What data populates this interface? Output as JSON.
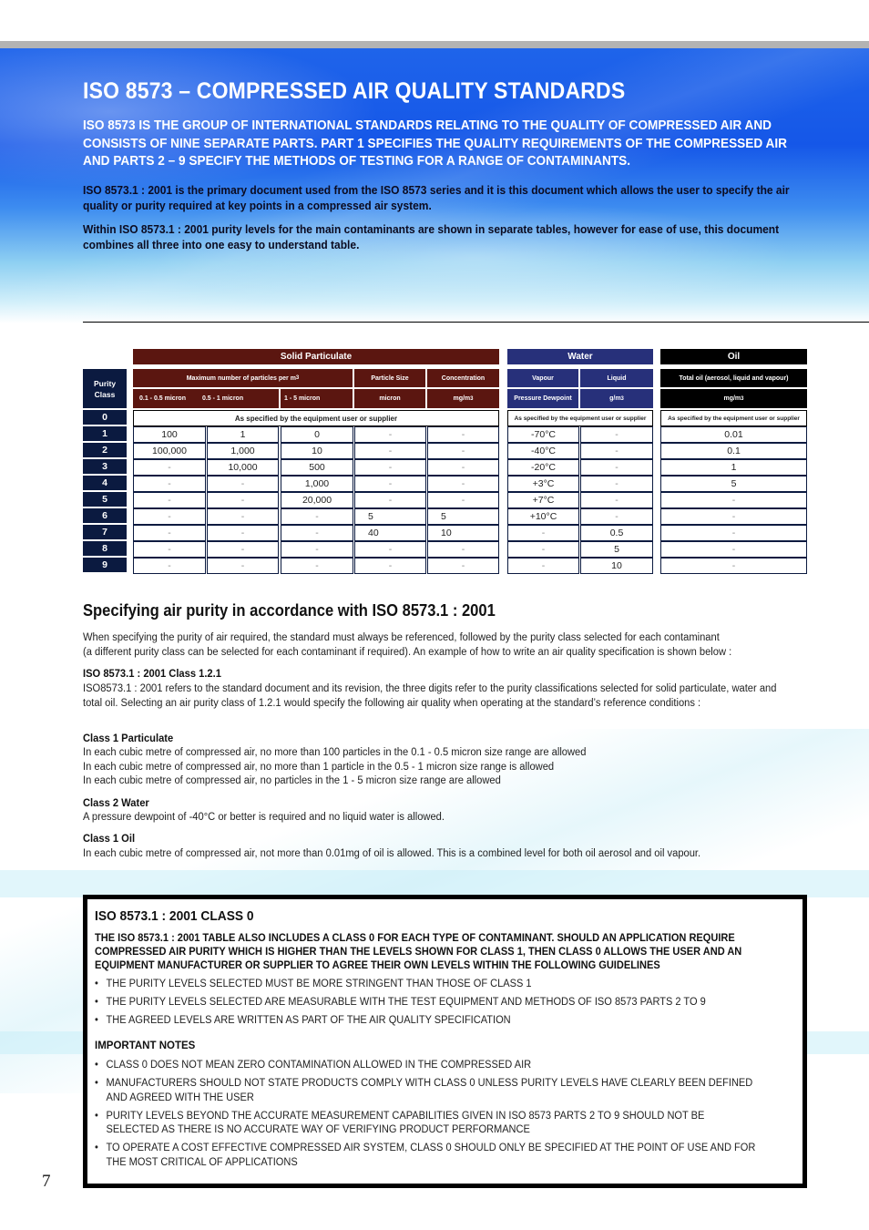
{
  "header": {
    "title": "ISO 8573 – COMPRESSED AIR QUALITY STANDARDS",
    "intro_caps": "ISO 8573 IS THE GROUP OF INTERNATIONAL STANDARDS RELATING TO THE QUALITY OF COMPRESSED AIR AND CONSISTS OF NINE SEPARATE PARTS. PART 1 SPECIFIES THE QUALITY REQUIREMENTS OF THE COMPRESSED AIR AND PARTS 2 – 9 SPECIFY THE METHODS OF TESTING FOR A RANGE OF CONTAMINANTS.",
    "intro_p1": "ISO 8573.1 : 2001 is the primary document used from the ISO 8573 series and it is this document which allows the user to specify the air quality or purity required at key points in a compressed air system.",
    "intro_p2": "Within ISO 8573.1 : 2001 purity levels for the main contaminants are shown in separate tables, however for ease of use, this document combines all three into one easy to understand table."
  },
  "colors": {
    "solid_header": "#5b1610",
    "water_header": "#27307a",
    "oil_header": "#000000",
    "class_header": "#0b1a40"
  },
  "table": {
    "purity_class_label": "Purity Class",
    "groups": {
      "solid": "Solid Particulate",
      "water": "Water",
      "oil": "Oil"
    },
    "subheaders": {
      "max_particles": "Maximum number of particles per m",
      "max_particles_sup": "3",
      "particle_size": "Particle Size",
      "concentration": "Concentration",
      "vapour": "Vapour",
      "liquid": "Liquid",
      "total_oil": "Total oil (aerosol, liquid and vapour)"
    },
    "units": {
      "p01_05": "0.1 - 0.5 micron",
      "p05_1": "0.5 - 1 micron",
      "p1_5": "1 - 5 micron",
      "micron": "micron",
      "mg_m3": "mg/m",
      "pressure_dewpoint": "Pressure Dewpoint",
      "g_m3": "g/m",
      "oil_mg_m3": "mg/m",
      "sup3": "3"
    },
    "class0_text": "As specified by the equipment user or supplier",
    "rows": [
      {
        "cls": "0"
      },
      {
        "cls": "1",
        "solid": [
          "100",
          "1",
          "0",
          "-",
          "-"
        ],
        "water": [
          "-70°C",
          "-"
        ],
        "oil": "0.01"
      },
      {
        "cls": "2",
        "solid": [
          "100,000",
          "1,000",
          "10",
          "-",
          "-"
        ],
        "water": [
          "-40°C",
          "-"
        ],
        "oil": "0.1"
      },
      {
        "cls": "3",
        "solid": [
          "-",
          "10,000",
          "500",
          "-",
          "-"
        ],
        "water": [
          "-20°C",
          "-"
        ],
        "oil": "1"
      },
      {
        "cls": "4",
        "solid": [
          "-",
          "-",
          "1,000",
          "-",
          "-"
        ],
        "water": [
          "+3°C",
          "-"
        ],
        "oil": "5"
      },
      {
        "cls": "5",
        "solid": [
          "-",
          "-",
          "20,000",
          "-",
          "-"
        ],
        "water": [
          "+7°C",
          "-"
        ],
        "oil": "-"
      },
      {
        "cls": "6",
        "solid": [
          "-",
          "-",
          "-",
          "5",
          "5"
        ],
        "water": [
          "+10°C",
          "-"
        ],
        "oil": "-"
      },
      {
        "cls": "7",
        "solid": [
          "-",
          "-",
          "-",
          "40",
          "10"
        ],
        "water": [
          "-",
          "0.5"
        ],
        "oil": "-"
      },
      {
        "cls": "8",
        "solid": [
          "-",
          "-",
          "-",
          "-",
          "-"
        ],
        "water": [
          "-",
          "5"
        ],
        "oil": "-"
      },
      {
        "cls": "9",
        "solid": [
          "-",
          "-",
          "-",
          "-",
          "-"
        ],
        "water": [
          "-",
          "10"
        ],
        "oil": "-"
      }
    ]
  },
  "spec": {
    "heading": "Specifying air purity in accordance with ISO 8573.1 : 2001",
    "intro_line1": "When specifying the purity of air required, the standard must always be referenced, followed by the purity class selected for each contaminant",
    "intro_line2": "(a different purity class can be selected for each contaminant if required). An example of how to write an air quality specification is shown below :",
    "example_label": "ISO 8573.1 : 2001 Class 1.2.1",
    "example_text": "ISO8573.1 : 2001 refers to the standard document and its revision, the three digits refer to the purity classifications selected for solid particulate, water and total oil. Selecting an air purity class of 1.2.1 would specify the following air quality when operating at the standard’s reference conditions :",
    "particulate_label": "Class 1 Particulate",
    "particulate_lines": [
      "In each cubic metre of compressed air, no more than 100 particles in the 0.1 - 0.5 micron size range are allowed",
      "In each cubic metre of compressed air, no more than 1 particle in the 0.5 - 1 micron size range is allowed",
      "In each cubic metre of compressed air, no particles in the 1 - 5 micron size range are allowed"
    ],
    "water_label": "Class 2 Water",
    "water_text": "A pressure dewpoint of -40°C or better is required and no liquid water is allowed.",
    "oil_label": "Class 1 Oil",
    "oil_text": "In each cubic metre of compressed air, not more than 0.01mg of oil is allowed. This is a combined level for both oil aerosol and oil vapour."
  },
  "class0_box": {
    "title": "ISO 8573.1 : 2001 CLASS 0",
    "lead": "THE ISO 8573.1 : 2001 TABLE ALSO INCLUDES A CLASS 0 FOR EACH TYPE OF CONTAMINANT. SHOULD AN APPLICATION REQUIRE COMPRESSED AIR PURITY WHICH IS HIGHER THAN THE LEVELS SHOWN FOR CLASS 1, THEN CLASS 0 ALLOWS THE USER AND AN EQUIPMENT MANUFACTURER OR SUPPLIER TO AGREE THEIR OWN LEVELS WITHIN THE FOLLOWING GUIDELINES",
    "guidelines": [
      "THE PURITY LEVELS SELECTED MUST BE MORE STRINGENT THAN THOSE OF CLASS 1",
      "THE PURITY LEVELS SELECTED ARE MEASURABLE WITH THE TEST EQUIPMENT AND METHODS OF ISO 8573 PARTS 2 TO 9",
      "THE AGREED LEVELS ARE WRITTEN AS PART OF THE AIR QUALITY SPECIFICATION"
    ],
    "notes_title": "IMPORTANT NOTES",
    "notes": [
      "CLASS 0 DOES NOT MEAN ZERO CONTAMINATION ALLOWED IN THE COMPRESSED AIR",
      "MANUFACTURERS SHOULD NOT STATE PRODUCTS COMPLY WITH CLASS 0 UNLESS PURITY LEVELS HAVE CLEARLY BEEN DEFINED AND AGREED WITH THE USER",
      "PURITY LEVELS BEYOND THE ACCURATE MEASUREMENT CAPABILITIES GIVEN IN ISO 8573 PARTS 2 TO 9 SHOULD NOT BE SELECTED AS THERE IS NO ACCURATE WAY OF VERIFYING PRODUCT PERFORMANCE",
      "TO OPERATE A COST EFFECTIVE COMPRESSED AIR SYSTEM, CLASS 0 SHOULD ONLY BE SPECIFIED AT THE POINT OF USE AND FOR THE MOST CRITICAL OF APPLICATIONS"
    ]
  },
  "page_number": "7"
}
